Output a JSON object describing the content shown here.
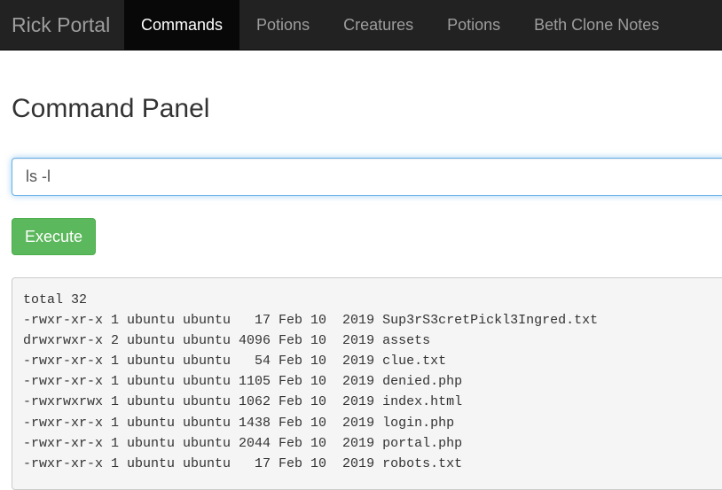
{
  "navbar": {
    "brand": "Rick Portal",
    "items": [
      {
        "label": "Commands",
        "active": true
      },
      {
        "label": "Potions",
        "active": false
      },
      {
        "label": "Creatures",
        "active": false
      },
      {
        "label": "Potions",
        "active": false
      },
      {
        "label": "Beth Clone Notes",
        "active": false
      }
    ]
  },
  "main": {
    "title": "Command Panel",
    "command_input_value": "ls -l",
    "execute_label": "Execute",
    "output_lines": [
      "total 32",
      "-rwxr-xr-x 1 ubuntu ubuntu   17 Feb 10  2019 Sup3rS3cretPickl3Ingred.txt",
      "drwxrwxr-x 2 ubuntu ubuntu 4096 Feb 10  2019 assets",
      "-rwxr-xr-x 1 ubuntu ubuntu   54 Feb 10  2019 clue.txt",
      "-rwxr-xr-x 1 ubuntu ubuntu 1105 Feb 10  2019 denied.php",
      "-rwxrwxrwx 1 ubuntu ubuntu 1062 Feb 10  2019 index.html",
      "-rwxr-xr-x 1 ubuntu ubuntu 1438 Feb 10  2019 login.php",
      "-rwxr-xr-x 1 ubuntu ubuntu 2044 Feb 10  2019 portal.php",
      "-rwxr-xr-x 1 ubuntu ubuntu   17 Feb 10  2019 robots.txt"
    ]
  },
  "colors": {
    "navbar_bg": "#222222",
    "nav_active_bg": "#080808",
    "nav_text": "#9d9d9d",
    "execute_button": "#5cb85c",
    "input_focus_border": "#66afe9",
    "output_bg": "#f5f5f5"
  }
}
